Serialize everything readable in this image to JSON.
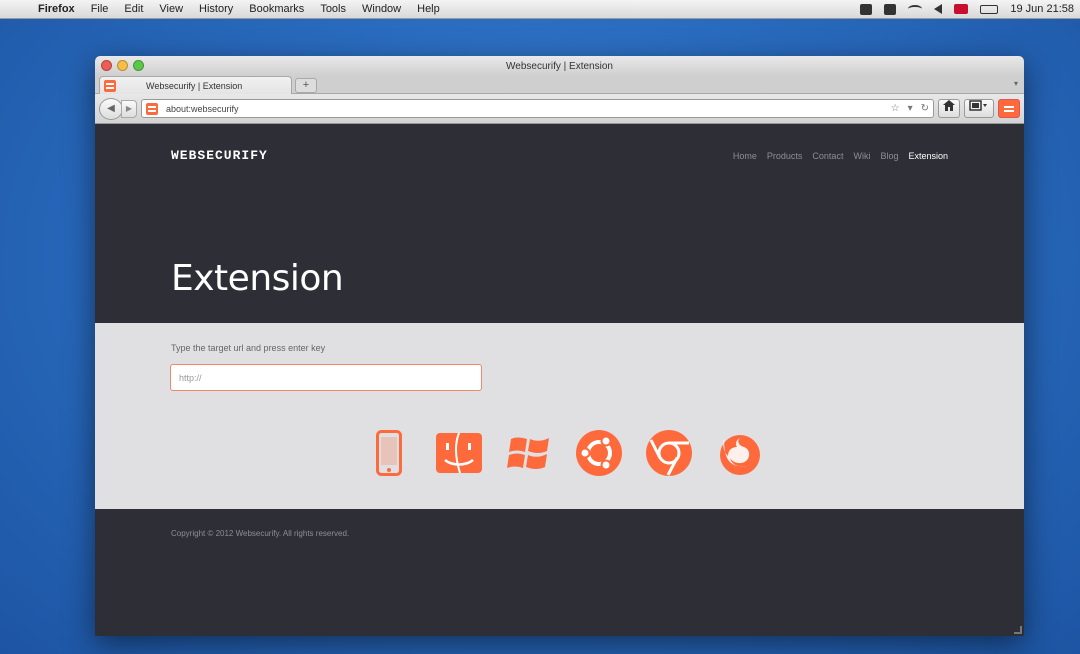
{
  "menubar": {
    "app": "Firefox",
    "items": [
      "File",
      "Edit",
      "View",
      "History",
      "Bookmarks",
      "Tools",
      "Window",
      "Help"
    ],
    "clock": "19 Jun 21:58"
  },
  "window": {
    "title": "Websecurify | Extension",
    "tab_title": "Websecurify | Extension",
    "new_tab_label": "+",
    "url": "about:websecurify"
  },
  "site": {
    "logo": "WEBSECURIFY",
    "nav": [
      "Home",
      "Products",
      "Contact",
      "Wiki",
      "Blog",
      "Extension"
    ],
    "hero_title": "Extension",
    "hint": "Type the target url and press enter key",
    "input_value": "http://",
    "platforms": [
      "mobile-icon",
      "finder-icon",
      "windows-icon",
      "ubuntu-icon",
      "chrome-icon",
      "firefox-icon"
    ],
    "copyright": "Copyright © 2012 Websecurify. All rights reserved.",
    "accent": "#ff6a3d"
  }
}
